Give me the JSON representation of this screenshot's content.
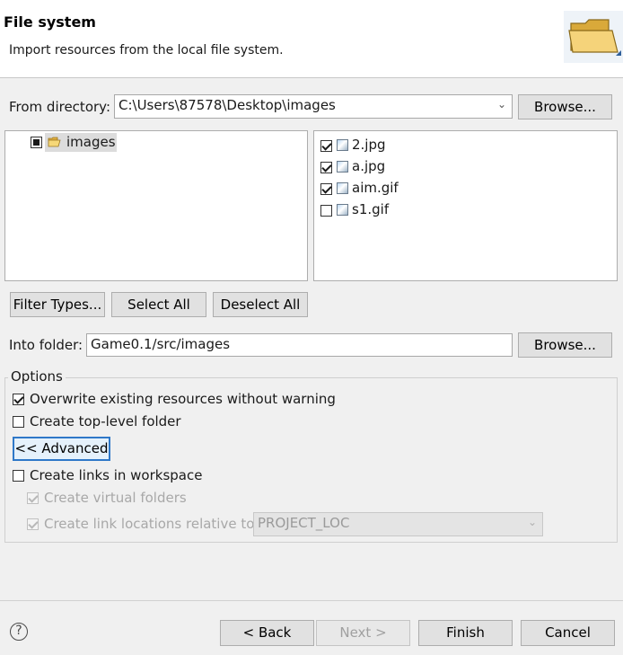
{
  "header": {
    "title": "File system",
    "subtitle": "Import resources from the local file system."
  },
  "source": {
    "label": "From directory:",
    "path": "C:\\Users\\87578\\Desktop\\images",
    "browse_label": "Browse..."
  },
  "tree": {
    "root": {
      "label": "images",
      "state": "partial"
    }
  },
  "files": [
    {
      "name": "2.jpg",
      "checked": true
    },
    {
      "name": "a.jpg",
      "checked": true
    },
    {
      "name": "aim.gif",
      "checked": true
    },
    {
      "name": "s1.gif",
      "checked": false
    }
  ],
  "selection_buttons": {
    "filter": "Filter Types...",
    "select_all": "Select All",
    "deselect_all": "Deselect All"
  },
  "target": {
    "label": "Into folder:",
    "value": "Game0.1/src/images",
    "browse_label": "Browse..."
  },
  "options": {
    "legend": "Options",
    "overwrite": {
      "label": "Overwrite existing resources without warning",
      "checked": true
    },
    "top_level": {
      "label": "Create top-level folder",
      "checked": false
    },
    "advanced_label": "<< Advanced",
    "links": {
      "label": "Create links in workspace",
      "checked": false
    },
    "virtual": {
      "label": "Create virtual folders",
      "checked": true,
      "enabled": false
    },
    "relative": {
      "label": "Create link locations relative to:",
      "checked": true,
      "enabled": false
    },
    "relative_value": "PROJECT_LOC"
  },
  "footer": {
    "back": "< Back",
    "next": "Next >",
    "finish": "Finish",
    "cancel": "Cancel",
    "help_glyph": "?"
  }
}
